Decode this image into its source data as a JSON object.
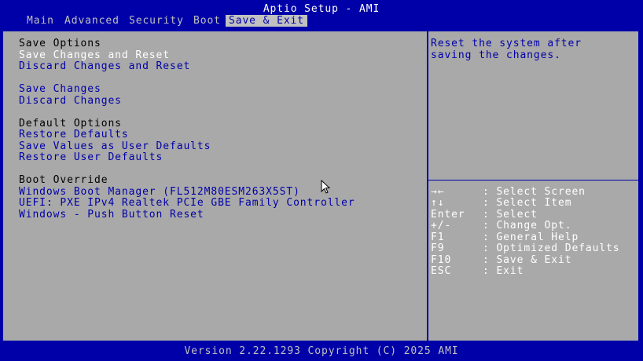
{
  "window": {
    "title": "Aptio Setup - AMI"
  },
  "tabs": [
    {
      "label": "Main"
    },
    {
      "label": "Advanced"
    },
    {
      "label": "Security"
    },
    {
      "label": "Boot"
    },
    {
      "label": "Save & Exit",
      "active": true
    }
  ],
  "sections": {
    "save_options": {
      "header": "Save Options",
      "items": [
        "Save Changes and Reset",
        "Discard Changes and Reset"
      ]
    },
    "save_changes": {
      "items": [
        "Save Changes",
        "Discard Changes"
      ]
    },
    "default_options": {
      "header": "Default Options",
      "items": [
        "Restore Defaults",
        "Save Values as User Defaults",
        "Restore User Defaults"
      ]
    },
    "boot_override": {
      "header": "Boot Override",
      "items": [
        "Windows Boot Manager (FL512M80ESM263X5ST)",
        "UEFI: PXE IPv4 Realtek PCIe GBE Family Controller",
        "Windows - Push Button Reset"
      ]
    }
  },
  "help": {
    "text": "Reset the system after saving the changes."
  },
  "keys": [
    {
      "key": "→←",
      "desc": ": Select Screen"
    },
    {
      "key": "↑↓",
      "desc": ": Select Item"
    },
    {
      "key": "Enter",
      "desc": ": Select"
    },
    {
      "key": "+/-",
      "desc": ": Change Opt."
    },
    {
      "key": "F1",
      "desc": ": General Help"
    },
    {
      "key": "F9",
      "desc": ": Optimized Defaults"
    },
    {
      "key": "F10",
      "desc": ": Save & Exit"
    },
    {
      "key": "ESC",
      "desc": ": Exit"
    }
  ],
  "footer": {
    "text": "Version 2.22.1293 Copyright (C) 2025 AMI"
  },
  "colors": {
    "background": "#0000a8",
    "panel": "#a9a9a9",
    "highlight": "#c0c0c0",
    "selected_text": "#ffffff"
  }
}
